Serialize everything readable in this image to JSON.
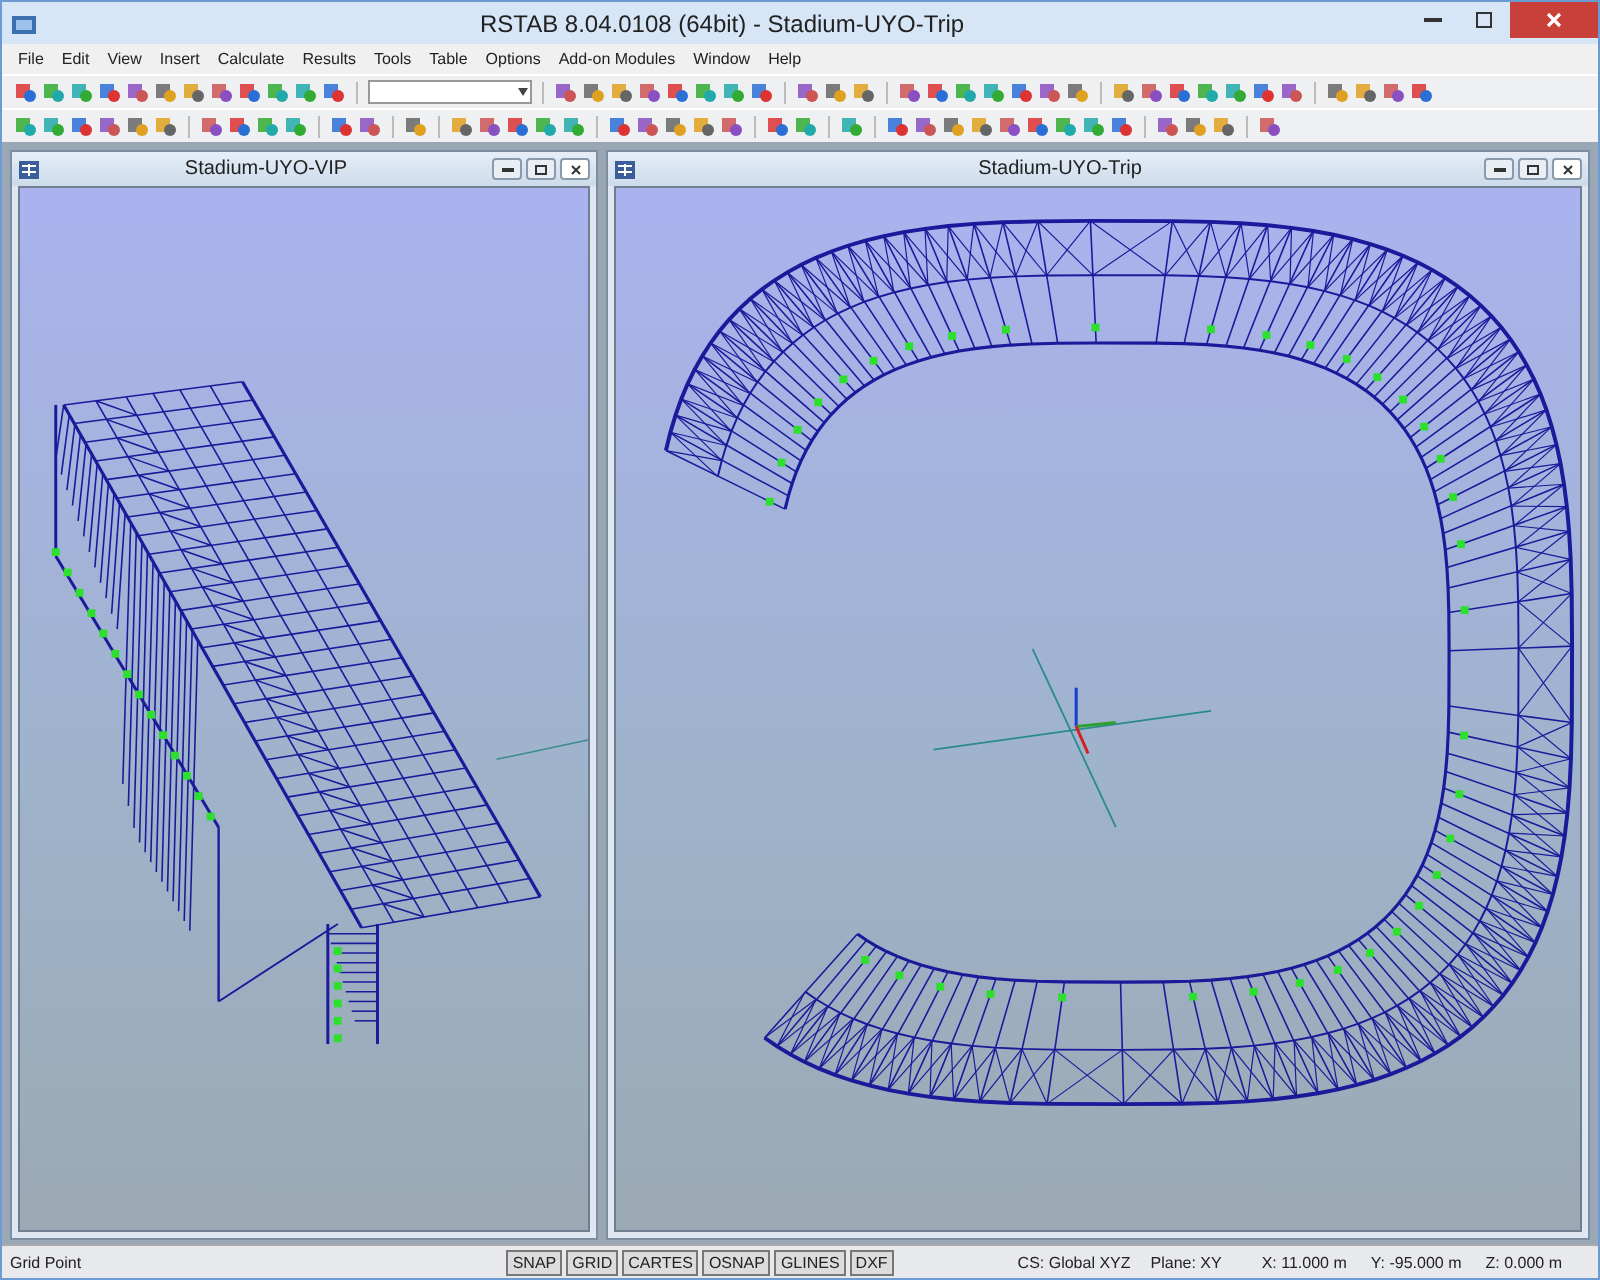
{
  "window": {
    "title": "RSTAB 8.04.0108 (64bit) - Stadium-UYO-Trip"
  },
  "menu": [
    "File",
    "Edit",
    "View",
    "Insert",
    "Calculate",
    "Results",
    "Tools",
    "Table",
    "Options",
    "Add-on Modules",
    "Window",
    "Help"
  ],
  "documents": [
    {
      "title": "Stadium-UYO-VIP",
      "kind": "roof"
    },
    {
      "title": "Stadium-UYO-Trip",
      "kind": "ring"
    }
  ],
  "status_bar": {
    "message": "Grid Point",
    "toggles": [
      "SNAP",
      "GRID",
      "CARTES",
      "OSNAP",
      "GLINES",
      "DXF"
    ],
    "coordinate_system": "CS: Global XYZ",
    "plane": "Plane: XY",
    "x": "X: 11.000 m",
    "y": "Y: -95.000 m",
    "z": "Z: 0.000 m"
  }
}
